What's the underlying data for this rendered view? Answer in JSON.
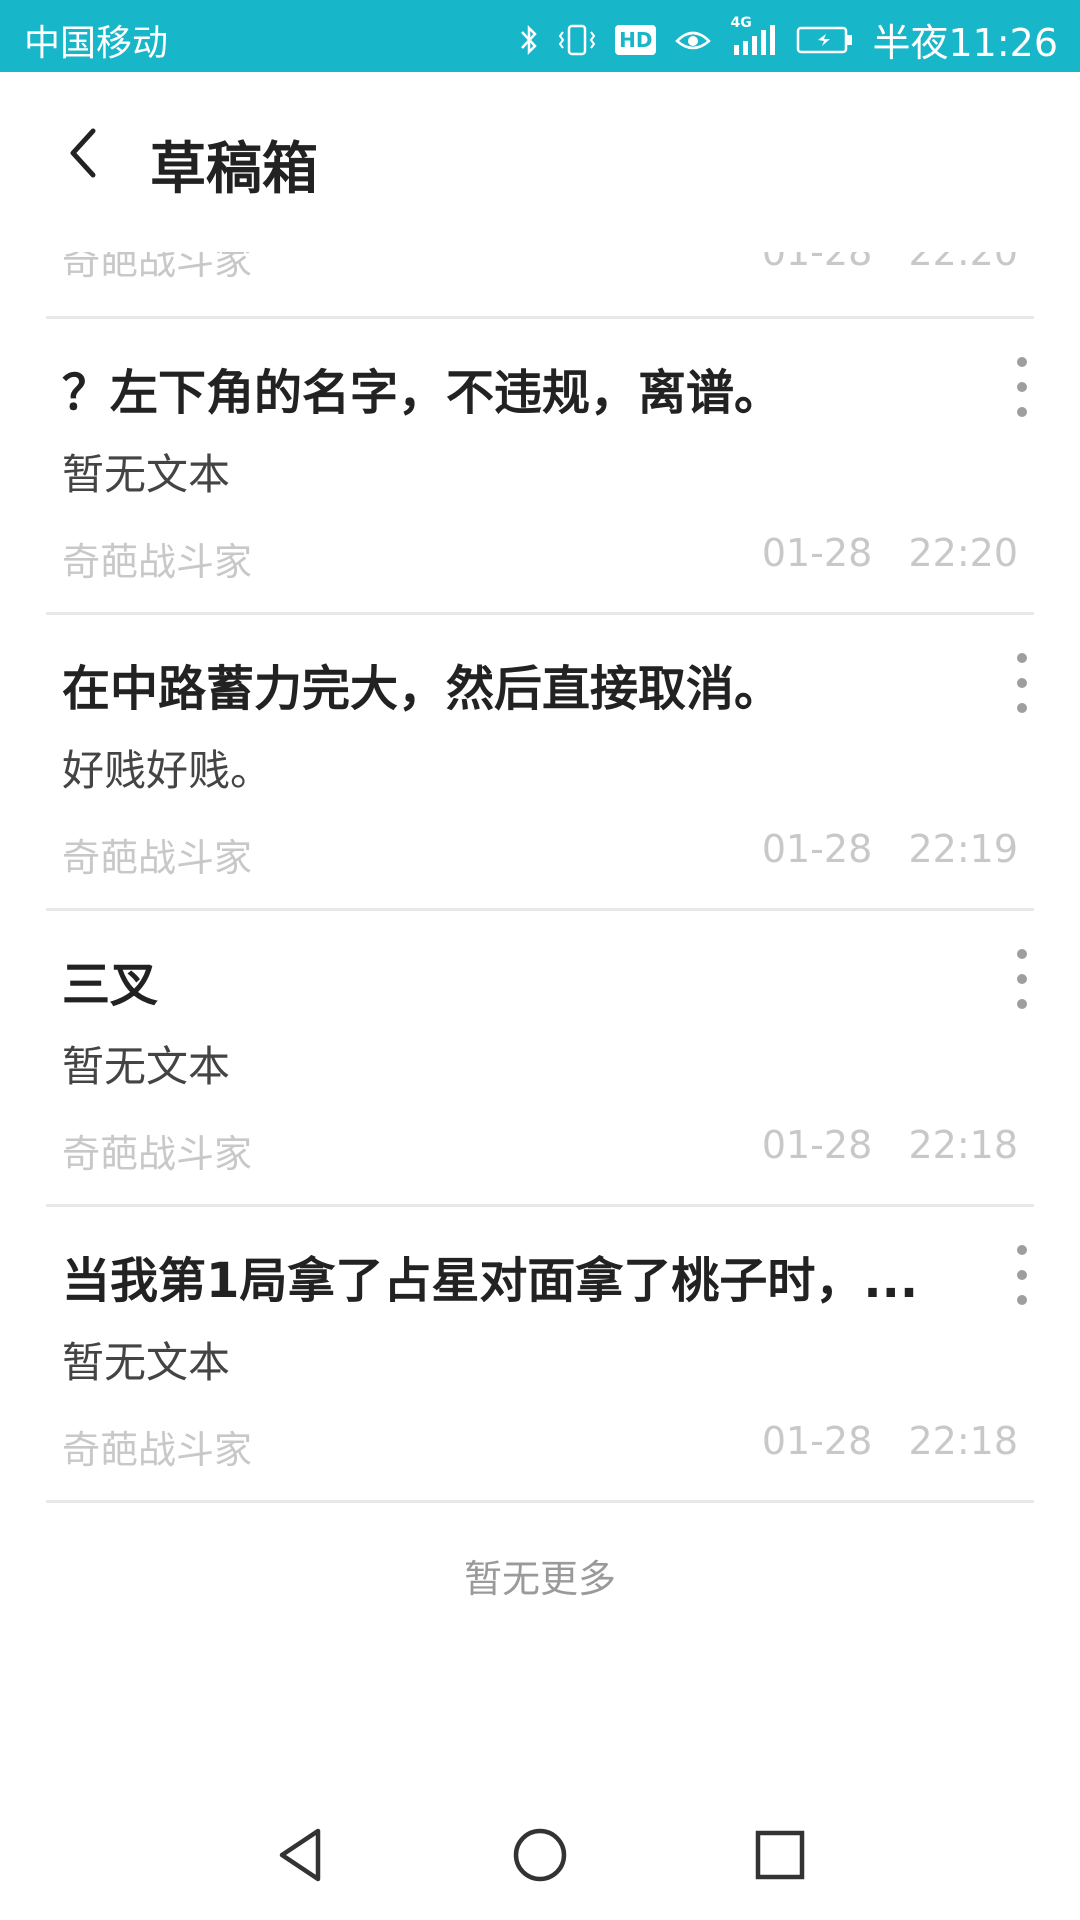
{
  "status_bar": {
    "carrier": "中国移动",
    "time": "半夜11:26",
    "icons": [
      "bluetooth-icon",
      "vibrate-icon",
      "hd-icon",
      "eye-icon",
      "signal-4g-icon",
      "battery-icon"
    ],
    "hd_label": "HD",
    "network_label": "4G",
    "color": "#18b6c9"
  },
  "header": {
    "title": "草稿箱",
    "back_icon": "chevron-left-icon"
  },
  "partial_row": {
    "author": "奇葩战斗家",
    "date": "01-28   22:20"
  },
  "drafts": [
    {
      "title": "？左下角的名字，不违规，离谱。",
      "body": "暂无文本",
      "author": "奇葩战斗家",
      "date": "01-28   22:20"
    },
    {
      "title": "在中路蓄力完大，然后直接取消。",
      "body": "好贱好贱。",
      "author": "奇葩战斗家",
      "date": "01-28   22:19"
    },
    {
      "title": "三叉",
      "body": "暂无文本",
      "author": "奇葩战斗家",
      "date": "01-28   22:18"
    },
    {
      "title": "当我第1局拿了占星对面拿了桃子时，...",
      "body": "暂无文本",
      "author": "奇葩战斗家",
      "date": "01-28   22:18"
    }
  ],
  "footer": {
    "no_more": "暂无更多"
  },
  "nav_bar": {
    "icons": [
      "back-triangle-icon",
      "home-circle-icon",
      "recents-square-icon"
    ]
  }
}
